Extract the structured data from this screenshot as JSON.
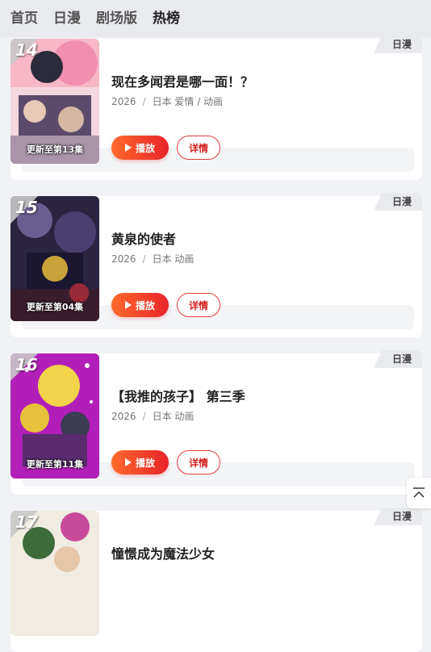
{
  "nav": {
    "items": [
      {
        "label": "首页"
      },
      {
        "label": "日漫"
      },
      {
        "label": "剧场版"
      },
      {
        "label": "热榜"
      }
    ]
  },
  "cards": [
    {
      "rank": "14",
      "category": "日漫",
      "title": "现在多闻君是哪一面！？",
      "year": "2026",
      "tags": "日本 爱情 / 动画",
      "episode": "更新至第13集",
      "play_label": "播放",
      "detail_label": "详情"
    },
    {
      "rank": "15",
      "category": "日漫",
      "title": "黄泉的使者",
      "year": "2026",
      "tags": "日本 动画",
      "episode": "更新至第04集",
      "play_label": "播放",
      "detail_label": "详情"
    },
    {
      "rank": "16",
      "category": "日漫",
      "title": "【我推的孩子】 第三季",
      "year": "2026",
      "tags": "日本 动画",
      "episode": "更新至第11集",
      "play_label": "播放",
      "detail_label": "详情"
    },
    {
      "rank": "17",
      "category": "日漫",
      "title": "憧憬成为魔法少女",
      "year": "",
      "tags": "",
      "episode": "",
      "play_label": "",
      "detail_label": ""
    }
  ],
  "colors": {
    "accent": "#e8232a",
    "highlight": "#ffd24d"
  },
  "icons": {
    "back_to_top": "arrow-up-to-top-icon",
    "play": "play-icon"
  }
}
